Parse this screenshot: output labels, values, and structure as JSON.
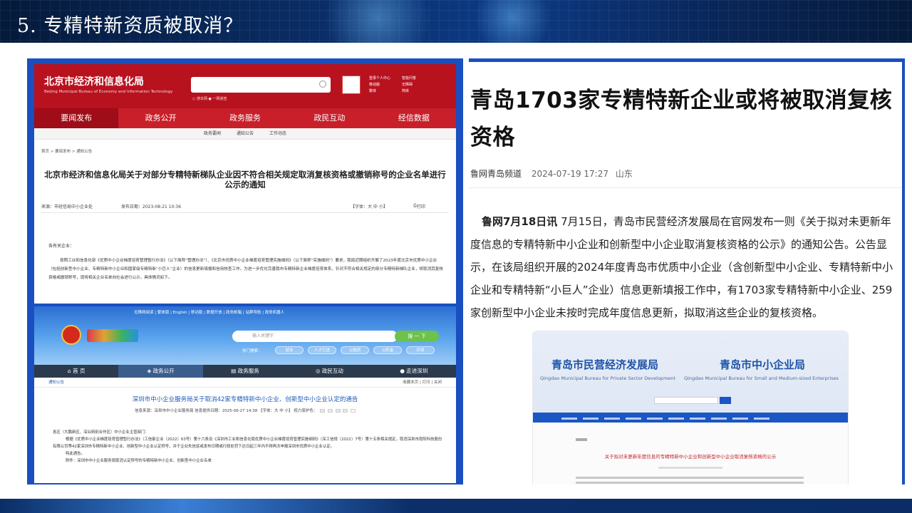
{
  "slide": {
    "title": "5.  专精特新资质被取消？"
  },
  "beijing": {
    "logo_cn": "北京市经济和信息化局",
    "logo_en": "Beijing Municipal Bureau of Economy and Information Technology",
    "search_options": "○ 搜本网   ● 一网通查",
    "right_links": [
      "登录个人中心",
      "移动版",
      "繁体",
      "智能问答",
      "无障碍",
      "简体"
    ],
    "nav": [
      "要闻发布",
      "政务公开",
      "政务服务",
      "政民互动",
      "经信数据"
    ],
    "subnav": [
      "政务要闻",
      "通知公告",
      "工作动态"
    ],
    "breadcrumb": "首页 > 要闻发布 > 通知公告",
    "title": "北京市经济和信息化局关于对部分专精特新梯队企业因不符合相关规定取消复核资格或撤销称号的企业名单进行公示的通知",
    "source": "来源：市经信局中小企业处",
    "date": "发布日期：2023-08-21 10:36",
    "font_size": "【字体：大 中 小】",
    "print": "打印",
    "salutation": "各有关企业：",
    "body": "按照工业和信息化部《优质中小企业梯度培育管理暂行办法》（以下简称“管理办法”）、《北京市优质中小企业梯度培育管理实施细则》（以下简称“实施细则”）要求，我局近期组织开展了2023年度北京市优质中小企业（包括创新型中小企业、专精特新中小企业和国家级专精特新“小巨人”企业）的信息更新填报和信用核查工作。为进一步优化完善我市专精特新企业梯度培育体系，针对不符合相关规定的部分专精特新梯队企业，将取消其复核资格或撤销称号，现将相关企业名单向社会进行公示，具体情况如下。"
  },
  "shenzhen": {
    "top_links": "无障碍阅读 | 繁体版 | English | 移动版 | 数据开放 | 政务邮箱 | 站群导航 | 政务机器人",
    "search_placeholder": "输入关键字",
    "search_button": "搜 一 下",
    "hot_label": "热门搜索：",
    "hot_tags": [
      "就业",
      "人才引进",
      "公租房",
      "公积金",
      "环保"
    ],
    "nav": [
      "首 页",
      "政务公开",
      "政务服务",
      "政民互动",
      "走进深圳"
    ],
    "section": "通知公告",
    "tools": "收藏本页 | 打印 | 关闭",
    "title": "深圳市中小企业服务局关于取消42家专精特新中小企业、创新型中小企业认定的通告",
    "meta": "信息来源：深圳市中小企业服务局    信息提供日期：2025-06-27 14:38    【字体：大 中 小】    视力保护色：",
    "swatches": [
      "#f5e0e8",
      "#e4f1e0",
      "#dfe9f7",
      "#efe8d6",
      "#ffffff"
    ],
    "body": [
      "各区（大鹏新区、深汕特别合作区）中小企业主管部门：",
      "根据《优质中小企业梯度培育管理暂行办法》（工信部企业〔2022〕63号）第十六条及《深圳市工业和信息化局优质中小企业梯度培育管理实施细则》（深工信规〔2022〕7号）第十五条相关规定，取消深圳市雨阳科技股份有限公司等42家深圳市专精特新中小企业、创新型中小企业认定称号，并于企业失信惩戒发布日期或行政处罚下达日起三年内不得再次申报深圳市优质中小企业认定。",
      "特此通告。",
      "附件：深圳市中小企业服务局取消认定称号的专精特新中小企业、创新型中小企业名单"
    ]
  },
  "qingdao": {
    "title": "青岛1703家专精特新企业或将被取消复核资格",
    "source": "鲁网青岛频道",
    "date": "2024-07-19 17:27",
    "region": "山东",
    "lead": "鲁网7月18日讯",
    "body": "7月15日，青岛市民营经济发展局在官网发布一则《关于拟对未更新年度信息的专精特新中小企业和创新型中小企业取消复核资格的公示》的通知公告。公告显示，在该局组织开展的2024年度青岛市优质中小企业（含创新型中小企业、专精特新中小企业和专精特新“小巨人”企业）信息更新填报工作中，有1703家专精特新中小企业、259家创新型中小企业未按时完成年度信息更新，拟取消这些企业的复核资格。",
    "embedded": {
      "org1": "青岛市民营经济发展局",
      "org1_en": "Qingdao Municipal Bureau for Private Sector Development",
      "org2": "青岛市中小企业局",
      "org2_en": "Qingdao Municipal Bureau for Small and Medium-sized Enterprises",
      "notice_title": "关于拟对未更新年度信息的专精特新中小企业和创新型中小企业取消复核资格的公示"
    }
  }
}
